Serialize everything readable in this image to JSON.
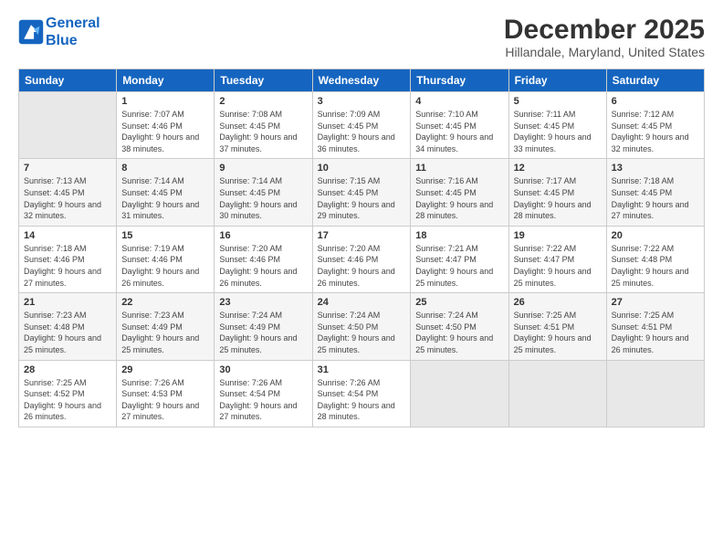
{
  "logo": {
    "line1": "General",
    "line2": "Blue"
  },
  "title": "December 2025",
  "subtitle": "Hillandale, Maryland, United States",
  "days_header": [
    "Sunday",
    "Monday",
    "Tuesday",
    "Wednesday",
    "Thursday",
    "Friday",
    "Saturday"
  ],
  "weeks": [
    [
      {
        "num": "",
        "empty": true
      },
      {
        "num": "1",
        "sunrise": "7:07 AM",
        "sunset": "4:46 PM",
        "daylight": "9 hours and 38 minutes."
      },
      {
        "num": "2",
        "sunrise": "7:08 AM",
        "sunset": "4:45 PM",
        "daylight": "9 hours and 37 minutes."
      },
      {
        "num": "3",
        "sunrise": "7:09 AM",
        "sunset": "4:45 PM",
        "daylight": "9 hours and 36 minutes."
      },
      {
        "num": "4",
        "sunrise": "7:10 AM",
        "sunset": "4:45 PM",
        "daylight": "9 hours and 34 minutes."
      },
      {
        "num": "5",
        "sunrise": "7:11 AM",
        "sunset": "4:45 PM",
        "daylight": "9 hours and 33 minutes."
      },
      {
        "num": "6",
        "sunrise": "7:12 AM",
        "sunset": "4:45 PM",
        "daylight": "9 hours and 32 minutes."
      }
    ],
    [
      {
        "num": "7",
        "sunrise": "7:13 AM",
        "sunset": "4:45 PM",
        "daylight": "9 hours and 32 minutes."
      },
      {
        "num": "8",
        "sunrise": "7:14 AM",
        "sunset": "4:45 PM",
        "daylight": "9 hours and 31 minutes."
      },
      {
        "num": "9",
        "sunrise": "7:14 AM",
        "sunset": "4:45 PM",
        "daylight": "9 hours and 30 minutes."
      },
      {
        "num": "10",
        "sunrise": "7:15 AM",
        "sunset": "4:45 PM",
        "daylight": "9 hours and 29 minutes."
      },
      {
        "num": "11",
        "sunrise": "7:16 AM",
        "sunset": "4:45 PM",
        "daylight": "9 hours and 28 minutes."
      },
      {
        "num": "12",
        "sunrise": "7:17 AM",
        "sunset": "4:45 PM",
        "daylight": "9 hours and 28 minutes."
      },
      {
        "num": "13",
        "sunrise": "7:18 AM",
        "sunset": "4:45 PM",
        "daylight": "9 hours and 27 minutes."
      }
    ],
    [
      {
        "num": "14",
        "sunrise": "7:18 AM",
        "sunset": "4:46 PM",
        "daylight": "9 hours and 27 minutes."
      },
      {
        "num": "15",
        "sunrise": "7:19 AM",
        "sunset": "4:46 PM",
        "daylight": "9 hours and 26 minutes."
      },
      {
        "num": "16",
        "sunrise": "7:20 AM",
        "sunset": "4:46 PM",
        "daylight": "9 hours and 26 minutes."
      },
      {
        "num": "17",
        "sunrise": "7:20 AM",
        "sunset": "4:46 PM",
        "daylight": "9 hours and 26 minutes."
      },
      {
        "num": "18",
        "sunrise": "7:21 AM",
        "sunset": "4:47 PM",
        "daylight": "9 hours and 25 minutes."
      },
      {
        "num": "19",
        "sunrise": "7:22 AM",
        "sunset": "4:47 PM",
        "daylight": "9 hours and 25 minutes."
      },
      {
        "num": "20",
        "sunrise": "7:22 AM",
        "sunset": "4:48 PM",
        "daylight": "9 hours and 25 minutes."
      }
    ],
    [
      {
        "num": "21",
        "sunrise": "7:23 AM",
        "sunset": "4:48 PM",
        "daylight": "9 hours and 25 minutes."
      },
      {
        "num": "22",
        "sunrise": "7:23 AM",
        "sunset": "4:49 PM",
        "daylight": "9 hours and 25 minutes."
      },
      {
        "num": "23",
        "sunrise": "7:24 AM",
        "sunset": "4:49 PM",
        "daylight": "9 hours and 25 minutes."
      },
      {
        "num": "24",
        "sunrise": "7:24 AM",
        "sunset": "4:50 PM",
        "daylight": "9 hours and 25 minutes."
      },
      {
        "num": "25",
        "sunrise": "7:24 AM",
        "sunset": "4:50 PM",
        "daylight": "9 hours and 25 minutes."
      },
      {
        "num": "26",
        "sunrise": "7:25 AM",
        "sunset": "4:51 PM",
        "daylight": "9 hours and 25 minutes."
      },
      {
        "num": "27",
        "sunrise": "7:25 AM",
        "sunset": "4:51 PM",
        "daylight": "9 hours and 26 minutes."
      }
    ],
    [
      {
        "num": "28",
        "sunrise": "7:25 AM",
        "sunset": "4:52 PM",
        "daylight": "9 hours and 26 minutes."
      },
      {
        "num": "29",
        "sunrise": "7:26 AM",
        "sunset": "4:53 PM",
        "daylight": "9 hours and 27 minutes."
      },
      {
        "num": "30",
        "sunrise": "7:26 AM",
        "sunset": "4:54 PM",
        "daylight": "9 hours and 27 minutes."
      },
      {
        "num": "31",
        "sunrise": "7:26 AM",
        "sunset": "4:54 PM",
        "daylight": "9 hours and 28 minutes."
      },
      {
        "num": "",
        "empty": true
      },
      {
        "num": "",
        "empty": true
      },
      {
        "num": "",
        "empty": true
      }
    ]
  ]
}
